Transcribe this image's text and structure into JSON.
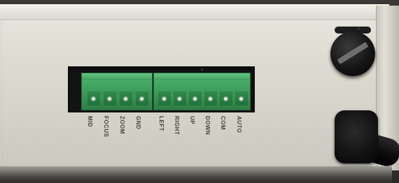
{
  "terminal_labels": [
    "MID",
    "FOCUS",
    "ZOOM",
    "GND",
    "LEFT",
    "RIGHT",
    "UP",
    "DOWN",
    "COM",
    "AUTO"
  ],
  "colors": {
    "panel": "#dddbd2",
    "terminal_block": "#3f9e5d",
    "label_text": "#444440",
    "knob": "#151515"
  },
  "icons": {
    "knob": "control-knob-icon",
    "grommet": "cable-grommet-icon"
  }
}
